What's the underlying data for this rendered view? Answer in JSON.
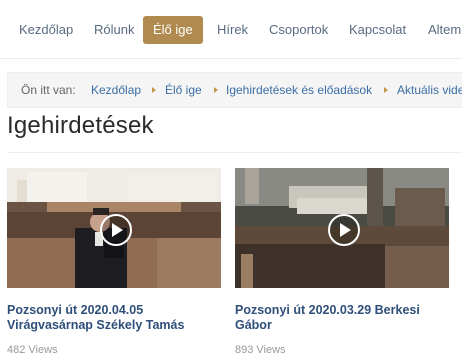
{
  "nav": {
    "items": [
      {
        "label": "Kezdőlap",
        "active": false
      },
      {
        "label": "Rólunk",
        "active": false
      },
      {
        "label": "Élő ige",
        "active": true
      },
      {
        "label": "Hírek",
        "active": false
      },
      {
        "label": "Csoportok",
        "active": false
      },
      {
        "label": "Kapcsolat",
        "active": false
      },
      {
        "label": "Altemp",
        "active": false
      }
    ],
    "active_color": "#b08a4f"
  },
  "breadcrumb": {
    "prefix": "Ön itt van:",
    "items": [
      "Kezdőlap",
      "Élő ige",
      "Igehirdetések és előadások",
      "Aktuális videó"
    ]
  },
  "page": {
    "title": "Igehirdetések"
  },
  "videos": [
    {
      "title": "Pozsonyi út 2020.04.05 Virágvasárnap Székely Tamás",
      "views": "482 Views",
      "icon": "play-icon"
    },
    {
      "title": "Pozsonyi út 2020.03.29 Berkesi Gábor",
      "views": "893 Views",
      "icon": "play-icon"
    }
  ]
}
